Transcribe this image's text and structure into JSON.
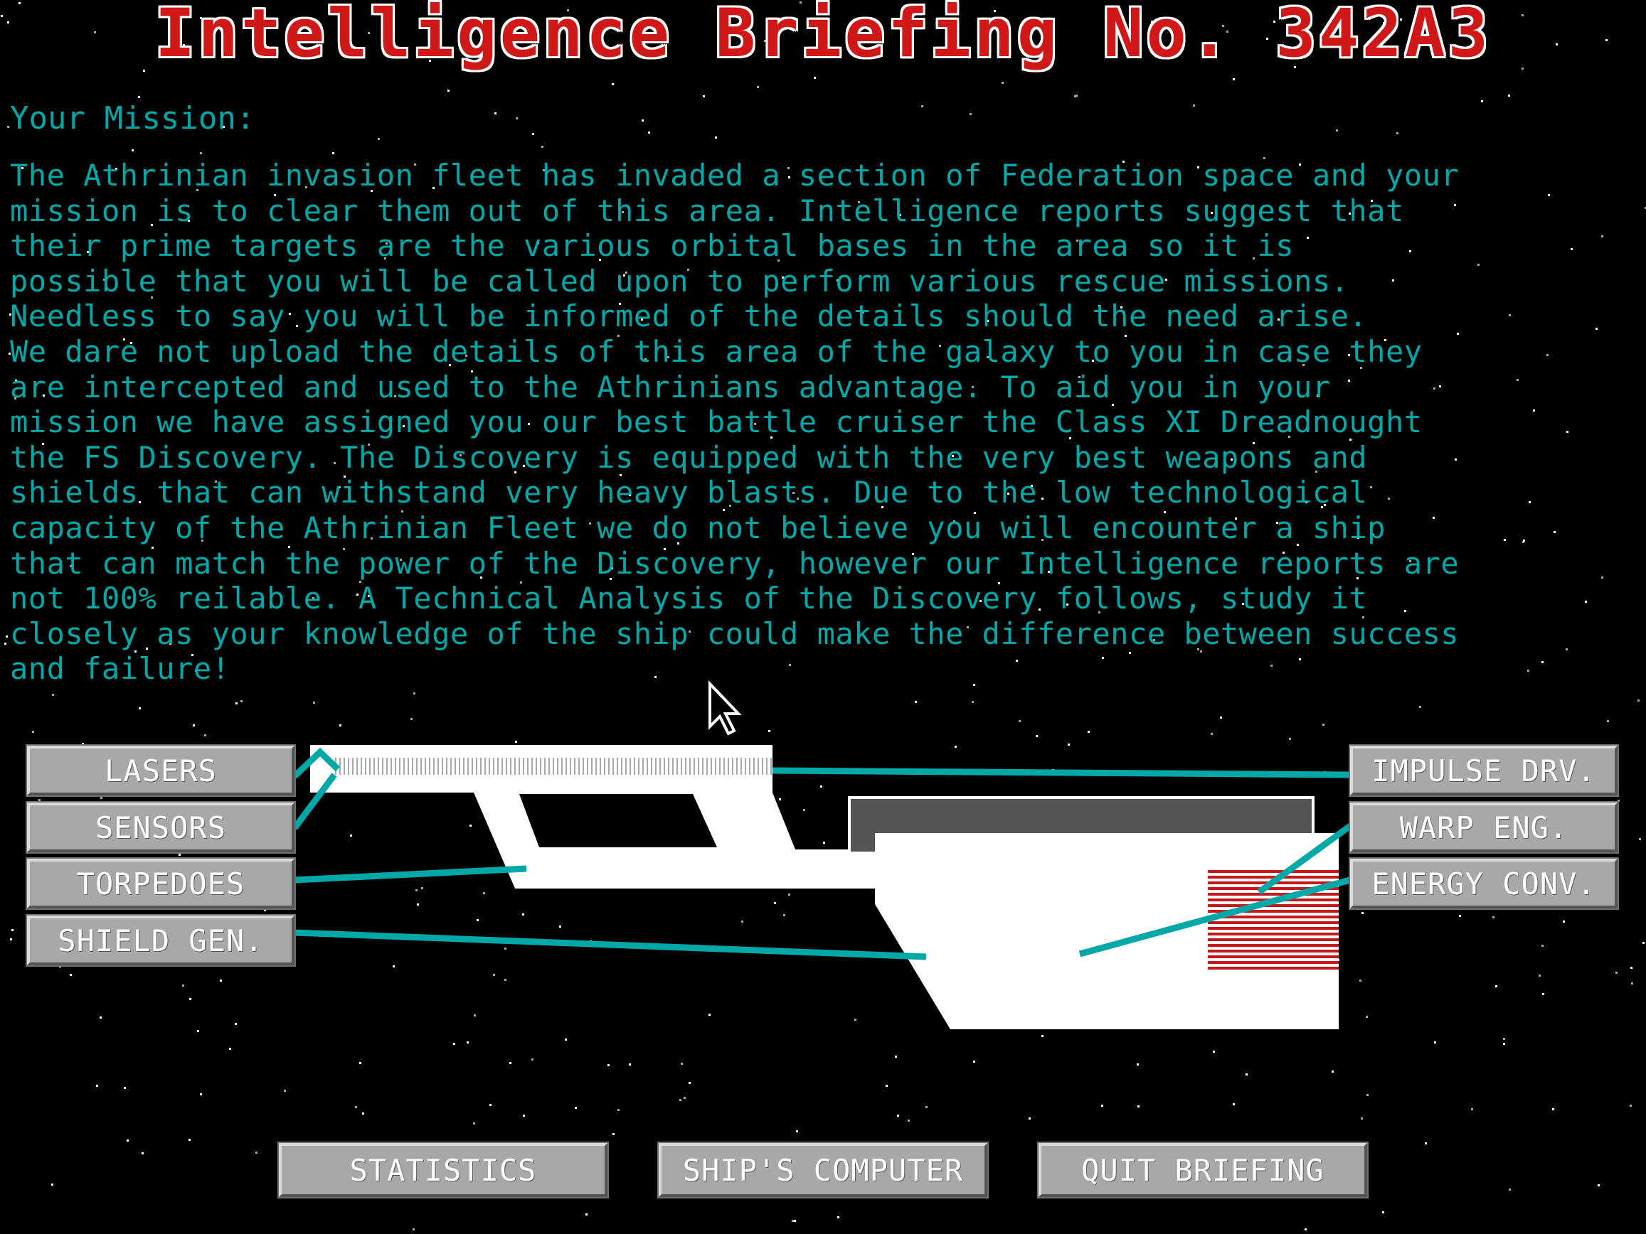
{
  "title": "Intelligence Briefing No. 342A3",
  "mission_label": "Your Mission:",
  "briefing_lines": [
    "The Athrinian invasion fleet has invaded a section of Federation space and your",
    "mission is to clear them out of this area. Intelligence reports suggest that",
    "their prime targets are the various orbital bases in the area so it is",
    "possible that you will be called upon to perform various rescue missions.",
    "Needless to say you will be informed of the details should the need arise.",
    "We dare not upload the details of this area of the galaxy to you in case they",
    "are intercepted and used to the Athrinians advantage. To aid you in your",
    "mission we have assigned you our best battle cruiser the Class XI Dreadnought",
    "the FS Discovery. The Discovery is equipped with the very best weapons and",
    "shields that can withstand very heavy blasts. Due to the low technological",
    "capacity of the Athrinian Fleet we do not believe you will encounter a ship",
    "that can match the power of the Discovery, however our Intelligence reports are",
    "not 100% reilable. A Technical Analysis of the Discovery follows, study it",
    "closely as your knowledge of the ship could make the difference between success",
    "and failure!"
  ],
  "systems_left": {
    "lasers": "LASERS",
    "sensors": "SENSORS",
    "torpedoes": "TORPEDOES",
    "shield_gen": "SHIELD GEN."
  },
  "systems_right": {
    "impulse_drv": "IMPULSE DRV.",
    "warp_eng": "WARP ENG.",
    "energy_conv": "ENERGY CONV."
  },
  "bottom_buttons": {
    "statistics": "STATISTICS",
    "ships_computer": "SHIP'S COMPUTER",
    "quit_briefing": "QUIT BRIEFING"
  },
  "colors": {
    "title_red": "#d01818",
    "text_cyan": "#00a8a8",
    "button_gray": "#a8a8a8",
    "ship_white": "#ffffff",
    "hot_red": "#c81818"
  }
}
